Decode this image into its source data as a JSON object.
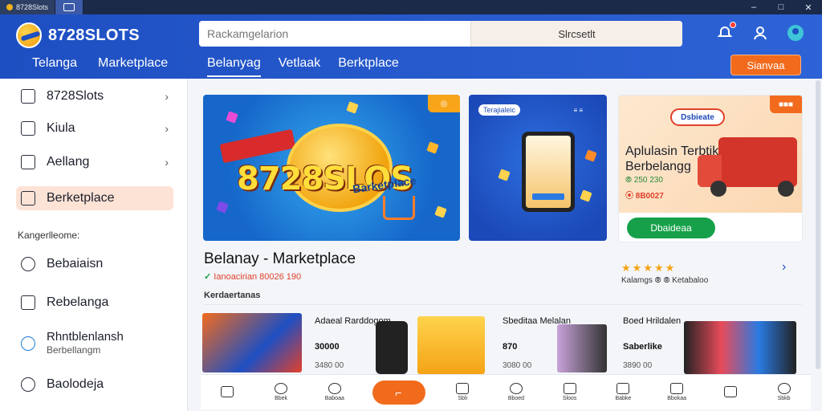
{
  "titlebar": {
    "tab_label": "8728Slots",
    "window_controls": [
      "–",
      "□",
      "✕"
    ]
  },
  "header": {
    "app_name": "8728SLOTS",
    "search_placeholder": "Rackamgelarion",
    "search_button": "Slrcsetlt",
    "nav_left": [
      "Telanga",
      "Marketplace"
    ],
    "nav_main": [
      "Belanyag",
      "Vetlaak",
      "Berktplace"
    ],
    "cta_label": "Sianvaa"
  },
  "sidebar": {
    "items": [
      {
        "label": "8728Slots",
        "icon": "home-icon"
      },
      {
        "label": "Kiula",
        "icon": "tag-icon"
      },
      {
        "label": "Aellang",
        "icon": "trash-icon"
      },
      {
        "label": "Berketplace",
        "icon": "store-icon"
      }
    ],
    "section_label": "Kangerlleome:",
    "section_items": [
      {
        "label": "Bebaiaisn",
        "sub": "",
        "icon": "chat-icon"
      },
      {
        "label": "Rebelanga",
        "sub": "",
        "icon": "bookmark-icon"
      },
      {
        "label": "Rhntblenlansh",
        "sub": "Berbellangm",
        "icon": "clock-icon"
      },
      {
        "label": "Baolodeja",
        "sub": "",
        "icon": "info-icon"
      }
    ]
  },
  "banners": {
    "main_title": "8728SLOS",
    "main_subtitle": "Barketplace",
    "main_tag": "◎",
    "second_label": "Terajialeic",
    "second_tag": "≡ ≡",
    "third_logo": "Dsbieate",
    "third_title_line1": "Aplulasin Terbtik",
    "third_title_line2": "Berbelangg",
    "third_meta": "⦾ 250 230",
    "third_meta2": "⦿ 8B0027",
    "third_button": "Dbaideaa",
    "third_tag": "■■■"
  },
  "section": {
    "title": "Belanay - Marketplace",
    "meta_check": "✓",
    "meta_text": "Ianoacirian 80026 190",
    "rating_stars": "★★★★★",
    "rating_meta": "Kalamgs ⦾ ⦾ Ketabaloo",
    "next_icon": "›",
    "subhead": "Kerdaertanas"
  },
  "products": [
    {
      "name": "",
      "price": "",
      "old": ""
    },
    {
      "name": "Adaeal Rarddogom",
      "price": "30000",
      "old": "3480 00"
    },
    {
      "name": "Sbeditaa Melalan",
      "price": "870",
      "old": "3080 00"
    },
    {
      "name": "Boed Hrildalen",
      "price": "Saberlike",
      "old": "3890 00"
    }
  ],
  "bottombar": [
    {
      "label": "",
      "icon": "home-icon"
    },
    {
      "label": "Bbek",
      "icon": "coin-icon"
    },
    {
      "label": "Baboaa",
      "icon": "timer-icon"
    },
    {
      "label": "⌐",
      "icon": "cart-icon",
      "main": true
    },
    {
      "label": "Sbli",
      "icon": "gift-icon"
    },
    {
      "label": "Bboed",
      "icon": "tag-icon"
    },
    {
      "label": "Sloos",
      "icon": "deal-icon"
    },
    {
      "label": "Babke",
      "icon": "wallet-icon"
    },
    {
      "label": "Bbokaa",
      "icon": "book-icon"
    },
    {
      "label": "",
      "icon": "mail-icon"
    },
    {
      "label": "Sbkb",
      "icon": "search-icon"
    }
  ],
  "colors": {
    "header_blue": "#1e4fc2",
    "accent_orange": "#f26b1d",
    "success_green": "#16a04a",
    "sidebar_active": "#fde3d6"
  }
}
